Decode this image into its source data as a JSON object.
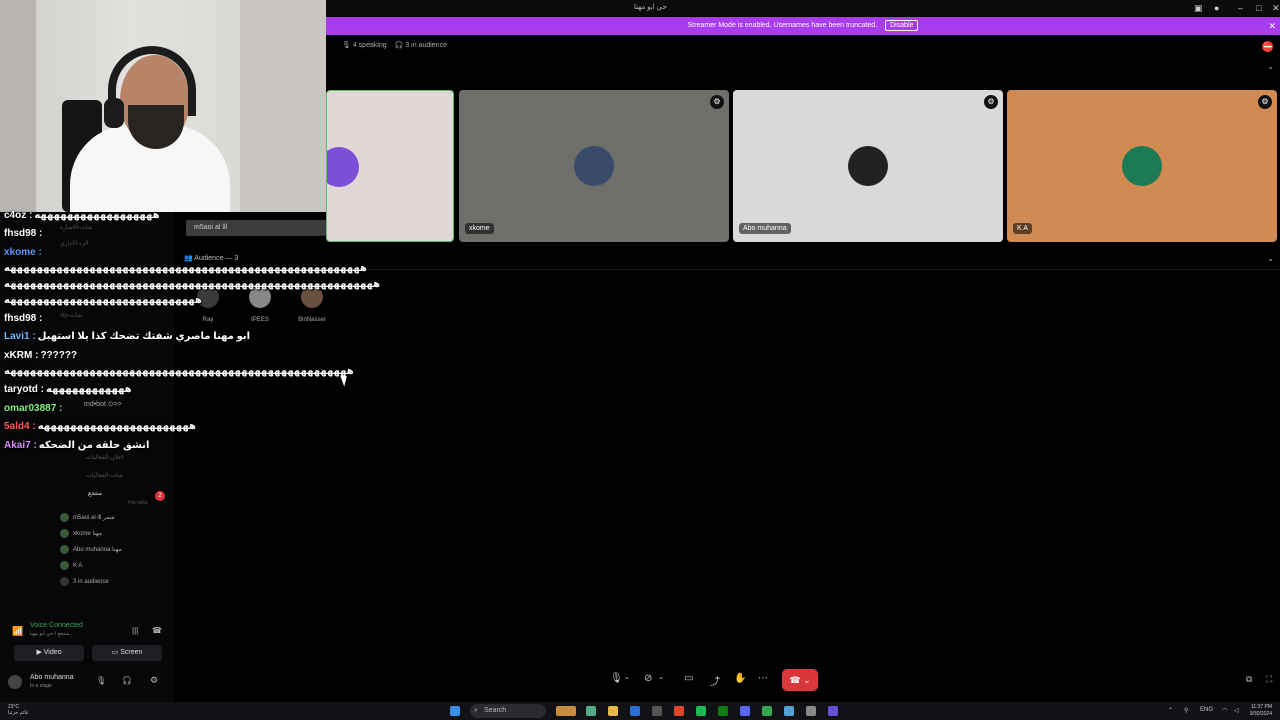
{
  "window": {
    "title": "حي ابو مهنا"
  },
  "banner": {
    "text": "Streamer Mode is enabled. Usernames have been truncated.",
    "button": "Disable"
  },
  "stage": {
    "speaking": "4 speaking",
    "audience_count": "3 in audience"
  },
  "tiles": [
    {
      "name": "m5aoi al lll",
      "bg": "#e2d7d7",
      "avatar_color": "#7b4fd6"
    },
    {
      "name": "xkome",
      "bg": "#6e6f6a",
      "avatar_color": "#3a4a6a"
    },
    {
      "name": "Abo muhanna",
      "bg": "#d9d9d9",
      "avatar_color": "#222222"
    },
    {
      "name": "K A",
      "bg": "#d08a52",
      "avatar_color": "#1c7a55"
    }
  ],
  "audience": {
    "label": "Audience — 3",
    "members": [
      {
        "name": "Ray",
        "color": "#3a3a3a"
      },
      {
        "name": "IPEES",
        "color": "#888888"
      },
      {
        "name": "BinNasser",
        "color": "#6a5040"
      }
    ]
  },
  "chat": [
    {
      "user": "c4oz :",
      "color": "#ffffff",
      "msg": "ههههههههههههههههههه"
    },
    {
      "user": "fhsd98 :",
      "color": "#ffffff",
      "msg": ""
    },
    {
      "user": "xkome :",
      "color": "#5b9bff",
      "msg": ""
    },
    {
      "user": "",
      "color": "#ffffff",
      "msg": "ههههههههههههههههههههههههههههههههههههههههههههههههههههههه"
    },
    {
      "user": "",
      "color": "#ffffff",
      "msg": "ههههههههههههههههههههههههههههههههههههههههههههههههههههههههه"
    },
    {
      "user": "",
      "color": "#ffffff",
      "msg": "هههههههههههههههههههههههههههههه"
    },
    {
      "user": "fhsd98 :",
      "color": "#ffffff",
      "msg": ""
    },
    {
      "user": "Lavi1 :",
      "color": "#6fb7ff",
      "msg": "ابو مهنا ماصري شفتك تضحك كذا يلا استهبل"
    },
    {
      "user": "xKRM :",
      "color": "#ffffff",
      "msg": "??????"
    },
    {
      "user": "",
      "color": "#ffffff",
      "msg": "ههههههههههههههههههههههههههههههههههههههههههههههههههههه"
    },
    {
      "user": "taryotd :",
      "color": "#ffffff",
      "msg": "ههههههههههههه"
    },
    {
      "user": "omar03887 :",
      "color": "#7ff07f",
      "msg": ""
    },
    {
      "user": "5ald4 :",
      "color": "#ff5a5a",
      "msg": "هههههههههههههههههههههههه"
    },
    {
      "user": "Akai7 :",
      "color": "#d88cff",
      "msg": "انشق حلقه من الضحكه"
    }
  ],
  "channels": [
    {
      "label": "شات-الاشاره",
      "kind": "text"
    },
    {
      "label": "الرد-الاداري",
      "kind": "text"
    },
    {
      "label": "vip-شات",
      "kind": "text"
    },
    {
      "label": "md•bot ⊙>>",
      "kind": "text"
    },
    {
      "label": "اعلان-الفعاليات",
      "kind": "text"
    },
    {
      "label": "شات-الفعاليات",
      "kind": "text"
    },
    {
      "label": "منتجع",
      "kind": "stage"
    },
    {
      "label": "Hot talks",
      "kind": "sub"
    }
  ],
  "stage_users": [
    {
      "name": "m5aoi al lll",
      "tag": "شمر"
    },
    {
      "name": "xkome",
      "tag": "مهنا"
    },
    {
      "name": "Abo muhanna",
      "tag": "مهنا"
    },
    {
      "name": "K A",
      "tag": ""
    },
    {
      "name": "3 in audience",
      "tag": ""
    }
  ],
  "voice": {
    "status": "Voice Connected",
    "channel": "منتجع / حي ابو مهنا",
    "video": "Video",
    "screen": "Screen"
  },
  "user": {
    "name": "Abo muhanna",
    "status": "In a stage"
  },
  "taskbar": {
    "weather_temp": "23°C",
    "weather_desc": "غائم جزئيا",
    "search": "Search",
    "lang": "ENG",
    "time": "11:37 PM",
    "date": "9/30/2024"
  }
}
